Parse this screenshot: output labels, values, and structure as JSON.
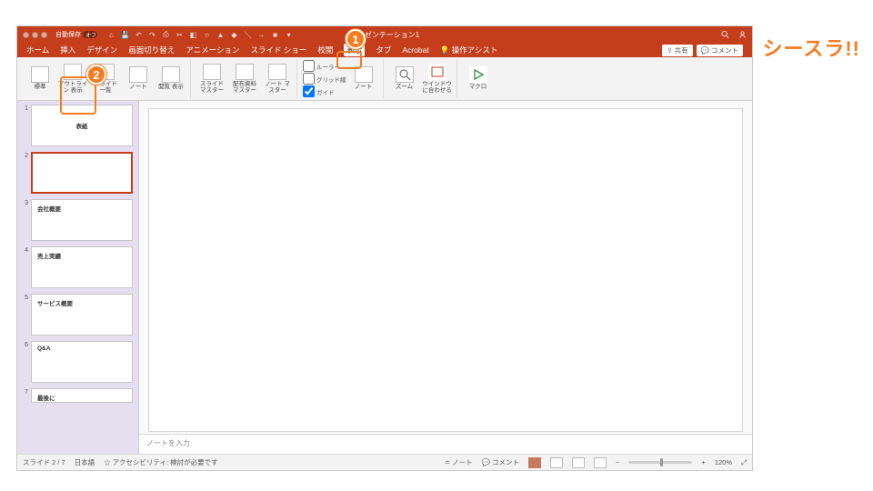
{
  "brand": "シースラ!!",
  "titlebar": {
    "autosave_label": "自動保存",
    "autosave_state": "オフ",
    "doc_title": "プレゼンテーション1"
  },
  "menu": {
    "items": [
      "ホーム",
      "挿入",
      "デザイン",
      "画面切り替え",
      "アニメーション",
      "スライド ショー",
      "校閲",
      "表示",
      "タブ",
      "Acrobat"
    ],
    "assist_icon": "bulb-icon",
    "assist_label": "操作アシスト",
    "share_label": "共有",
    "comment_label": "コメント",
    "active_index": 7
  },
  "ribbon": {
    "g1": [
      {
        "label": "標準"
      },
      {
        "label": "アウトライン\n表示"
      },
      {
        "label": "スライド\n一覧"
      },
      {
        "label": "ノート"
      },
      {
        "label": "閲覧\n表示"
      }
    ],
    "g2": [
      {
        "label": "スライド\nマスター"
      },
      {
        "label": "配布資料\nマスター"
      },
      {
        "label": "ノート\nマスター"
      }
    ],
    "g3_checks": [
      {
        "label": "ルーラー",
        "checked": false
      },
      {
        "label": "グリッド線",
        "checked": false
      },
      {
        "label": "ガイド",
        "checked": true
      }
    ],
    "g3_note": {
      "label": "ノート"
    },
    "g4": [
      {
        "label": "ズーム"
      },
      {
        "label": "ウインドウ\nに合わせる"
      }
    ],
    "g5": [
      {
        "label": "マクロ"
      }
    ]
  },
  "slides": [
    {
      "num": 1,
      "title": "表紙",
      "layout": "center",
      "selected": false
    },
    {
      "num": 2,
      "title": "",
      "layout": "blank",
      "selected": true
    },
    {
      "num": 3,
      "title": "会社概要",
      "layout": "tl",
      "selected": false
    },
    {
      "num": 4,
      "title": "売上実績",
      "layout": "tl",
      "selected": false
    },
    {
      "num": 5,
      "title": "サービス概要",
      "layout": "tl",
      "selected": false
    },
    {
      "num": 6,
      "title": "Q&A",
      "layout": "tl",
      "selected": false
    },
    {
      "num": 7,
      "title": "最後に",
      "layout": "tl",
      "selected": false
    }
  ],
  "notes_placeholder": "ノートを入力",
  "status": {
    "slide_pos": "スライド 2 / 7",
    "lang": "日本語",
    "a11y_label": "アクセシビリティ: 検討が必要です",
    "notes_btn": "ノート",
    "comments_btn": "コメント",
    "zoom_pct": "120%"
  },
  "callouts": {
    "c1": "1",
    "c2": "2"
  }
}
